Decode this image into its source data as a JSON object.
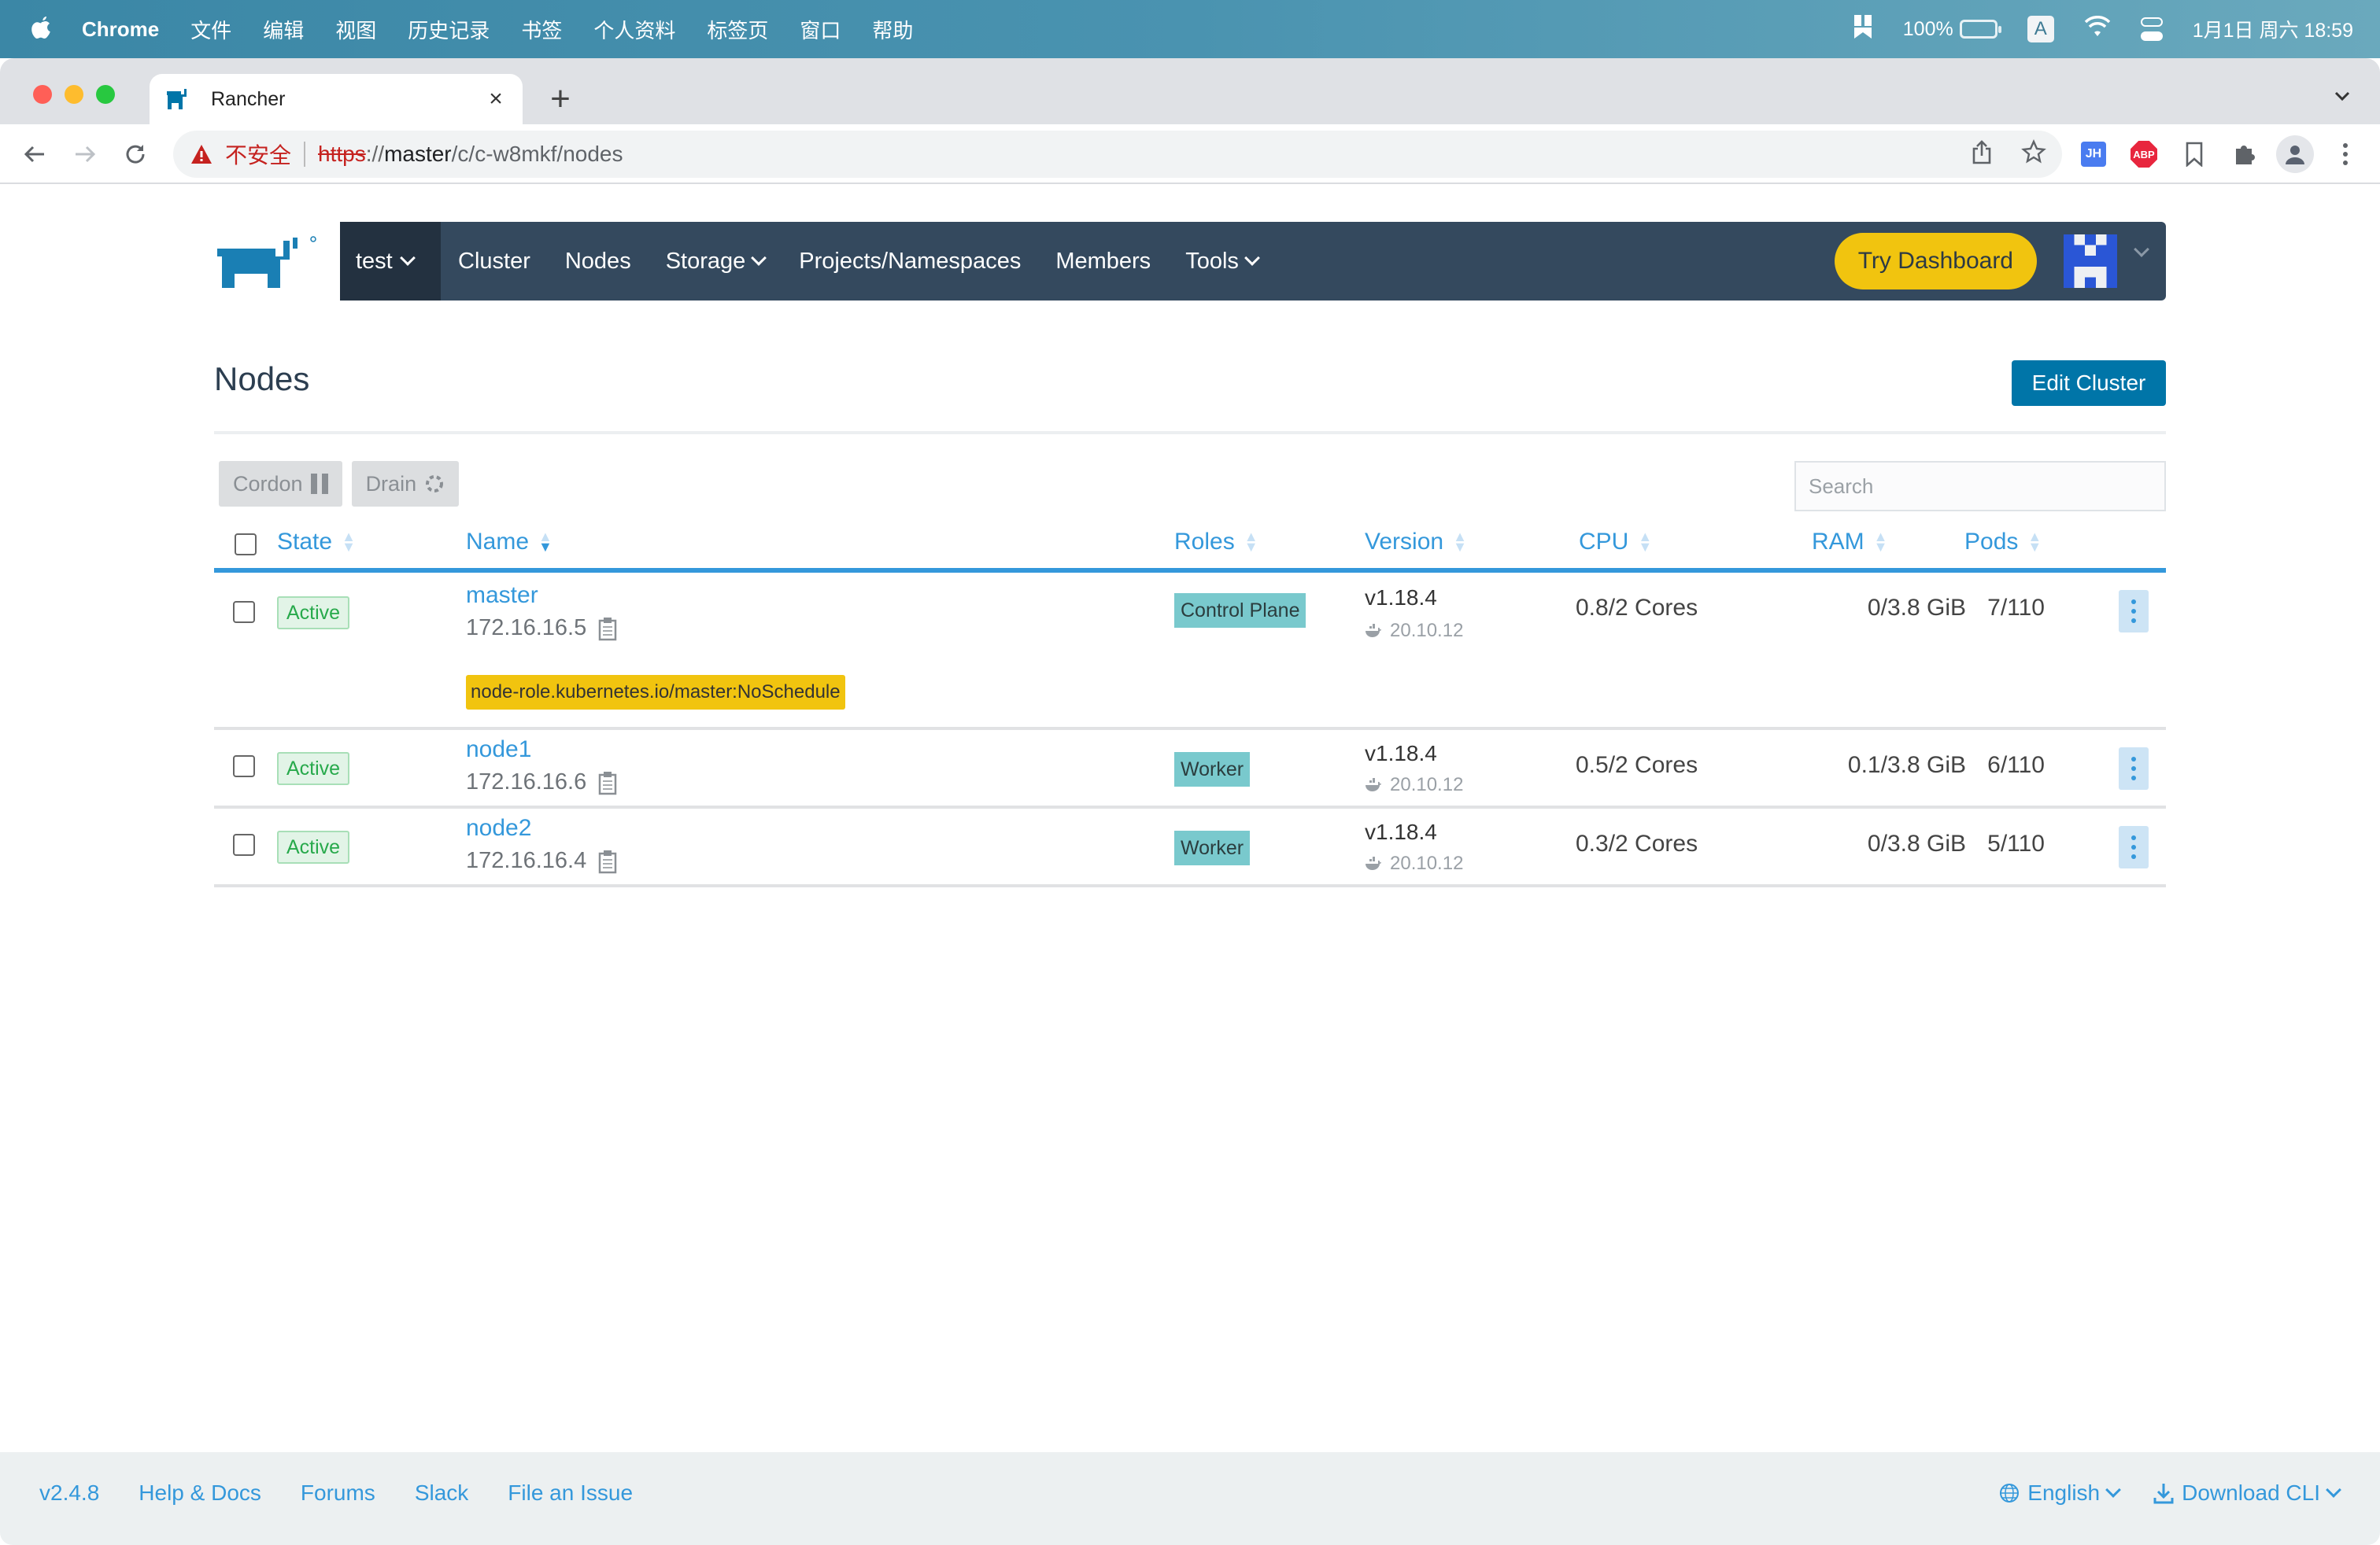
{
  "menubar": {
    "app_name": "Chrome",
    "items": [
      "文件",
      "编辑",
      "视图",
      "历史记录",
      "书签",
      "个人资料",
      "标签页",
      "窗口",
      "帮助"
    ],
    "battery": "100%",
    "input_method": "A",
    "datetime": "1月1日 周六  18:59"
  },
  "browser": {
    "tab_title": "Rancher",
    "close_glyph": "×",
    "new_tab_glyph": "+",
    "security_label": "不安全",
    "url_scheme": "https",
    "url_sep": "://",
    "url_host": "master",
    "url_path": "/c/c-w8mkf/nodes",
    "extensions": [
      "JH",
      "ABP"
    ]
  },
  "nav": {
    "cluster": "test",
    "items": [
      {
        "label": "Cluster",
        "dropdown": false
      },
      {
        "label": "Nodes",
        "dropdown": false
      },
      {
        "label": "Storage",
        "dropdown": true
      },
      {
        "label": "Projects/Namespaces",
        "dropdown": false
      },
      {
        "label": "Members",
        "dropdown": false
      },
      {
        "label": "Tools",
        "dropdown": true
      }
    ],
    "try_dashboard": "Try Dashboard"
  },
  "page": {
    "title": "Nodes",
    "edit_cluster": "Edit Cluster",
    "cordon": "Cordon",
    "drain": "Drain",
    "search_placeholder": "Search"
  },
  "table": {
    "columns": [
      "State",
      "Name",
      "Roles",
      "Version",
      "CPU",
      "RAM",
      "Pods"
    ],
    "sorted_column": "Name",
    "rows": [
      {
        "state": "Active",
        "name": "master",
        "ip": "172.16.16.5",
        "taint": "node-role.kubernetes.io/master:NoSchedule",
        "role": "Control Plane",
        "version": "v1.18.4",
        "docker": "20.10.12",
        "cpu": "0.8/2 Cores",
        "ram": "0/3.8 GiB",
        "pods": "7/110"
      },
      {
        "state": "Active",
        "name": "node1",
        "ip": "172.16.16.6",
        "taint": "",
        "role": "Worker",
        "version": "v1.18.4",
        "docker": "20.10.12",
        "cpu": "0.5/2 Cores",
        "ram": "0.1/3.8 GiB",
        "pods": "6/110"
      },
      {
        "state": "Active",
        "name": "node2",
        "ip": "172.16.16.4",
        "taint": "",
        "role": "Worker",
        "version": "v1.18.4",
        "docker": "20.10.12",
        "cpu": "0.3/2 Cores",
        "ram": "0/3.8 GiB",
        "pods": "5/110"
      }
    ]
  },
  "footer": {
    "version": "v2.4.8",
    "links": [
      "Help & Docs",
      "Forums",
      "Slack",
      "File an Issue"
    ],
    "language": "English",
    "download": "Download CLI"
  },
  "colors": {
    "nav_bg": "#34495e",
    "accent": "#3498db",
    "primary_button": "#0075a8",
    "try_dashboard": "#f1c40f",
    "active_green": "#27a94b",
    "role_teal": "#79c9cd"
  }
}
